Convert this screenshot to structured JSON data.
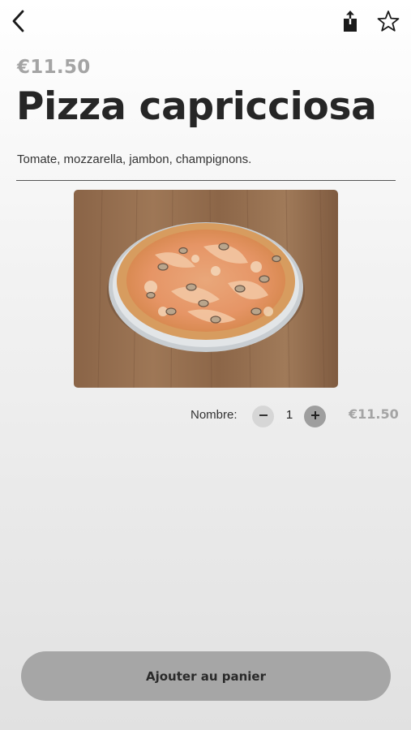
{
  "header": {
    "back_icon": "chevron-left-icon",
    "share_icon": "share-icon",
    "favorite_icon": "star-outline-icon"
  },
  "product": {
    "price": "€11.50",
    "name": "Pizza capricciosa",
    "description": "Tomate, mozzarella, jambon, champignons.",
    "image_icon": "pizza-photo"
  },
  "quantity": {
    "label": "Nombre:",
    "minus_label": "−",
    "value": "1",
    "plus_label": "+",
    "total": "€11.50"
  },
  "cart": {
    "button_label": "Ajouter au panier"
  },
  "colors": {
    "price_gray": "#a4a4a4",
    "button_gray": "#a6a6a6",
    "plus_gray": "#9e9e9e",
    "minus_gray": "#d6d6d6"
  }
}
